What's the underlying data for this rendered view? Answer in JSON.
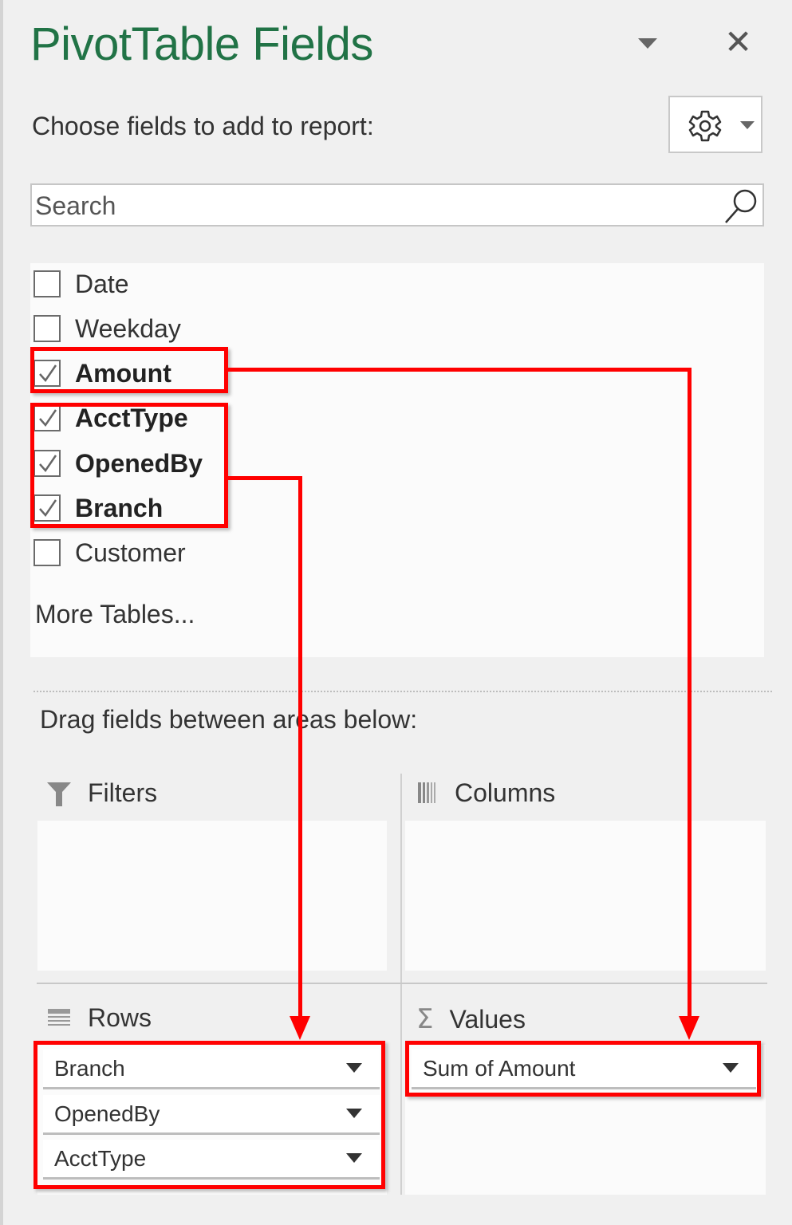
{
  "panel": {
    "title": "PivotTable Fields",
    "choose_label": "Choose fields to add to report:",
    "search_placeholder": "Search",
    "more_tables": "More Tables...",
    "drag_label": "Drag fields between areas below:"
  },
  "fields": [
    {
      "label": "Date",
      "checked": false
    },
    {
      "label": "Weekday",
      "checked": false
    },
    {
      "label": "Amount",
      "checked": true
    },
    {
      "label": "AcctType",
      "checked": true
    },
    {
      "label": "OpenedBy",
      "checked": true
    },
    {
      "label": "Branch",
      "checked": true
    },
    {
      "label": "Customer",
      "checked": false
    }
  ],
  "areas": {
    "filters": {
      "label": "Filters",
      "icon": "filter-icon",
      "items": []
    },
    "columns": {
      "label": "Columns",
      "icon": "columns-icon",
      "items": []
    },
    "rows": {
      "label": "Rows",
      "icon": "rows-icon",
      "items": [
        "Branch",
        "OpenedBy",
        "AcctType"
      ]
    },
    "values": {
      "label": "Values",
      "icon": "sigma-icon",
      "items": [
        "Sum of Amount"
      ]
    }
  },
  "annotations": {
    "color": "#ff0000"
  },
  "colors": {
    "title": "#217346"
  }
}
